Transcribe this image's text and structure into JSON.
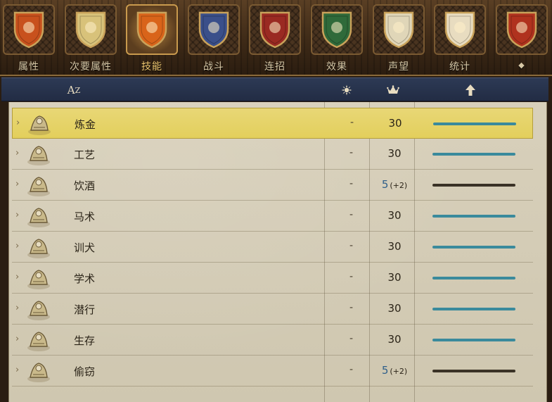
{
  "tabs": [
    {
      "label": "属性",
      "icon": "knight-shield-icon",
      "color": "#c8511d",
      "active": false
    },
    {
      "label": "次要属性",
      "icon": "cross-shield-icon",
      "color": "#d8c27a",
      "active": false
    },
    {
      "label": "技能",
      "icon": "fleur-shield-icon",
      "color": "#d9641a",
      "active": true
    },
    {
      "label": "战斗",
      "icon": "sword-shield-icon",
      "color": "#3a4f8a",
      "active": false
    },
    {
      "label": "连招",
      "icon": "figure-shield-icon",
      "color": "#9a2a22",
      "active": false
    },
    {
      "label": "效果",
      "icon": "fist-shield-icon",
      "color": "#2f6a3a",
      "active": false
    },
    {
      "label": "声望",
      "icon": "noose-shield-icon",
      "color": "#e0d6b8",
      "active": false
    },
    {
      "label": "统计",
      "icon": "target-shield-icon",
      "color": "#e8dcc0",
      "active": false
    },
    {
      "label": "",
      "icon": "boar-shield-icon",
      "color": "#b0321e",
      "active": false
    }
  ],
  "header": {
    "sort_label": "A",
    "sort_sub": "Z",
    "col_icons": [
      "sun-icon",
      "crown-icon",
      "up-arrow-icon"
    ]
  },
  "skills": [
    {
      "name": "炼金",
      "dash": "-",
      "value": "30",
      "bonus": "",
      "buffed": false,
      "bar_color": "#3a8a9c",
      "selected": true,
      "icon": "alchemy-icon"
    },
    {
      "name": "工艺",
      "dash": "-",
      "value": "30",
      "bonus": "",
      "buffed": false,
      "bar_color": "#3a8a9c",
      "selected": false,
      "icon": "craft-icon"
    },
    {
      "name": "饮酒",
      "dash": "-",
      "value": "5",
      "bonus": "(+2)",
      "buffed": true,
      "bar_color": "#3a3226",
      "selected": false,
      "icon": "drinking-icon"
    },
    {
      "name": "马术",
      "dash": "-",
      "value": "30",
      "bonus": "",
      "buffed": false,
      "bar_color": "#3a8a9c",
      "selected": false,
      "icon": "horse-icon"
    },
    {
      "name": "训犬",
      "dash": "-",
      "value": "30",
      "bonus": "",
      "buffed": false,
      "bar_color": "#3a8a9c",
      "selected": false,
      "icon": "dog-icon"
    },
    {
      "name": "学术",
      "dash": "-",
      "value": "30",
      "bonus": "",
      "buffed": false,
      "bar_color": "#3a8a9c",
      "selected": false,
      "icon": "book-icon"
    },
    {
      "name": "潜行",
      "dash": "-",
      "value": "30",
      "bonus": "",
      "buffed": false,
      "bar_color": "#3a8a9c",
      "selected": false,
      "icon": "stealth-icon"
    },
    {
      "name": "生存",
      "dash": "-",
      "value": "30",
      "bonus": "",
      "buffed": false,
      "bar_color": "#3a8a9c",
      "selected": false,
      "icon": "deer-icon"
    },
    {
      "name": "偷窃",
      "dash": "-",
      "value": "5",
      "bonus": "(+2)",
      "buffed": true,
      "bar_color": "#3a3226",
      "selected": false,
      "icon": "thief-icon"
    }
  ]
}
